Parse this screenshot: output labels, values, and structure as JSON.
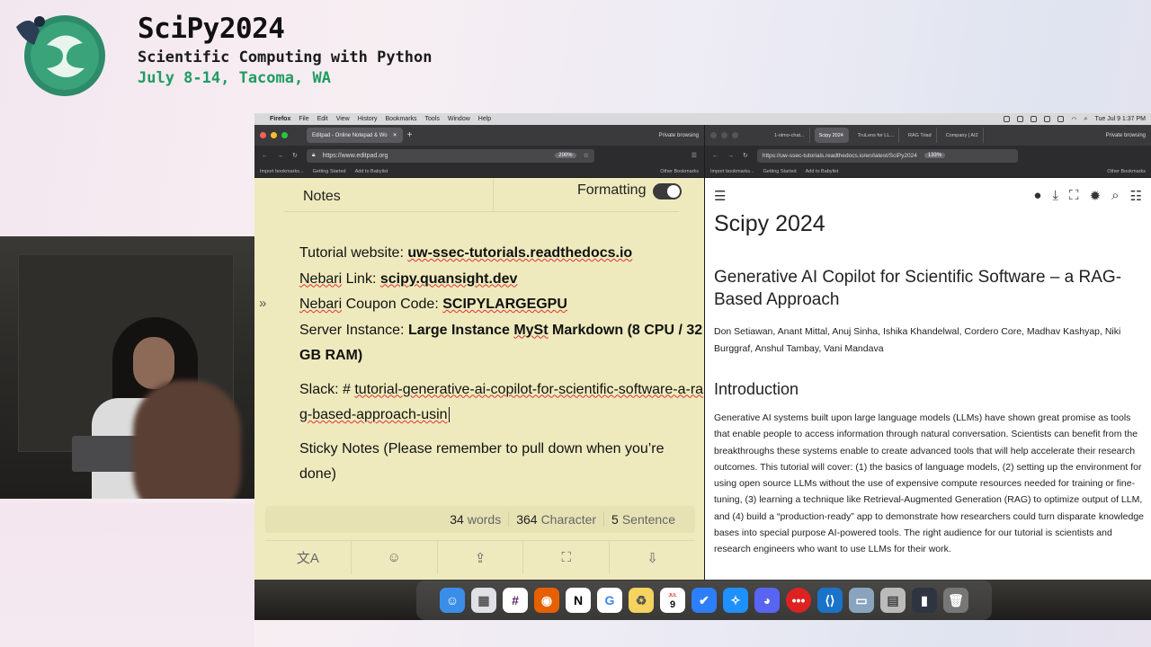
{
  "header": {
    "title": "SciPy2024",
    "subtitle": "Scientific Computing with Python",
    "dates": "July 8-14, Tacoma, WA"
  },
  "colors": {
    "accent_green": "#1f9d62",
    "notes_bg": "#eeeabd"
  },
  "menubar": {
    "app": "Firefox",
    "items": [
      "File",
      "Edit",
      "View",
      "History",
      "Bookmarks",
      "Tools",
      "Window",
      "Help"
    ],
    "clock": "Tue Jul 9  1:37 PM"
  },
  "left_window": {
    "tab_title": "Editpad - Online Notepad & Wo",
    "private": "Private browsing",
    "url": "https://www.editpad.org",
    "zoom": "200%",
    "bookmarks": [
      "Import bookmarks...",
      "Getting Started",
      "Add to Babylist"
    ],
    "other_bookmarks": "Other Bookmarks",
    "notes_label": "Notes",
    "formatting_label": "Formatting",
    "side_arrow": "»",
    "lines": {
      "l1_label": "Tutorial website: ",
      "l1_value": "uw-ssec-tutorials.readthedocs.io",
      "l2_label_a": "Nebari",
      "l2_label_b": " Link: ",
      "l2_value": "scipy.quansight.dev",
      "l3_label_a": "Nebari",
      "l3_label_b": " Coupon Code: ",
      "l3_value": "SCIPYLARGEGPU",
      "l4_label": "Server Instance: ",
      "l4_value_a": "Large Instance ",
      "l4_value_b": "MySt",
      "l4_value_c": " Markdown (8 CPU / 32 GB RAM)",
      "l5_label": "Slack: # ",
      "l5_value": "tutorial-generative-ai-copilot-for-scientific-software-a-rag-based-approach-usin",
      "l6": "Sticky Notes (Please remember to pull down when you’re done)"
    },
    "stats": [
      {
        "value": "34",
        "label": "words"
      },
      {
        "value": "364",
        "label": "Character"
      },
      {
        "value": "5",
        "label": "Sentence"
      }
    ],
    "toolbar": [
      {
        "icon": "translate-icon",
        "glyph": "文A"
      },
      {
        "icon": "emoji-icon",
        "glyph": "☺"
      },
      {
        "icon": "upload-icon",
        "glyph": "⇪"
      },
      {
        "icon": "fullscreen-icon",
        "glyph": "⛶"
      },
      {
        "icon": "download-icon",
        "glyph": "⇩"
      }
    ]
  },
  "right_window": {
    "tabs": [
      "1-olmo-chat...",
      "Scipy 2024",
      "TruLens for LL...",
      "RAG Triad",
      "Company | AI2"
    ],
    "private": "Private browsing",
    "url": "https://uw-ssec-tutorials.readthedocs.io/en/latest/SciPy2024",
    "zoom": "133%",
    "bookmarks": [
      "Import bookmarks...",
      "Getting Started",
      "Add to Babylist"
    ],
    "other_bookmarks": "Other Bookmarks",
    "page_title": "Scipy 2024",
    "heading": "Generative AI Copilot for Scientific Software – a RAG-Based Approach",
    "authors": "Don Setiawan, Anant Mittal, Anuj Sinha, Ishika Khandelwal, Cordero Core, Madhav Kashyap, Niki Burggraf, Anshul Tambay, Vani Mandava",
    "section": "Introduction",
    "body": "Generative AI systems built upon large language models (LLMs) have shown great promise as tools that enable people to access information through natural conversation. Scientists can benefit from the breakthroughs these systems enable to create advanced tools that will help accelerate their research outcomes. This tutorial will cover: (1) the basics of language models, (2) setting up the environment for using open source LLMs without the use of expensive compute resources needed for training or fine-tuning, (3) learning a technique like Retrieval-Augmented Generation (RAG) to optimize output of LLM, and (4) build a “production-ready” app to demonstrate how researchers could turn disparate knowledge bases into special purpose AI-powered tools. The right audience for our tutorial is scientists and research engineers who want to use LLMs for their work."
  },
  "dock": {
    "calendar_month": "JUL",
    "calendar_day": "9",
    "apps": [
      "finder-icon",
      "launchpad-icon",
      "slack-icon",
      "firefox-icon",
      "notion-icon",
      "chrome-icon",
      "recycle-icon",
      "calendar-icon",
      "todo-icon",
      "safari-icon",
      "discord-icon",
      "dots-app-icon",
      "vscode-icon",
      "preview-icon",
      "files-icon",
      "terminal-icon",
      "trash-icon"
    ]
  }
}
